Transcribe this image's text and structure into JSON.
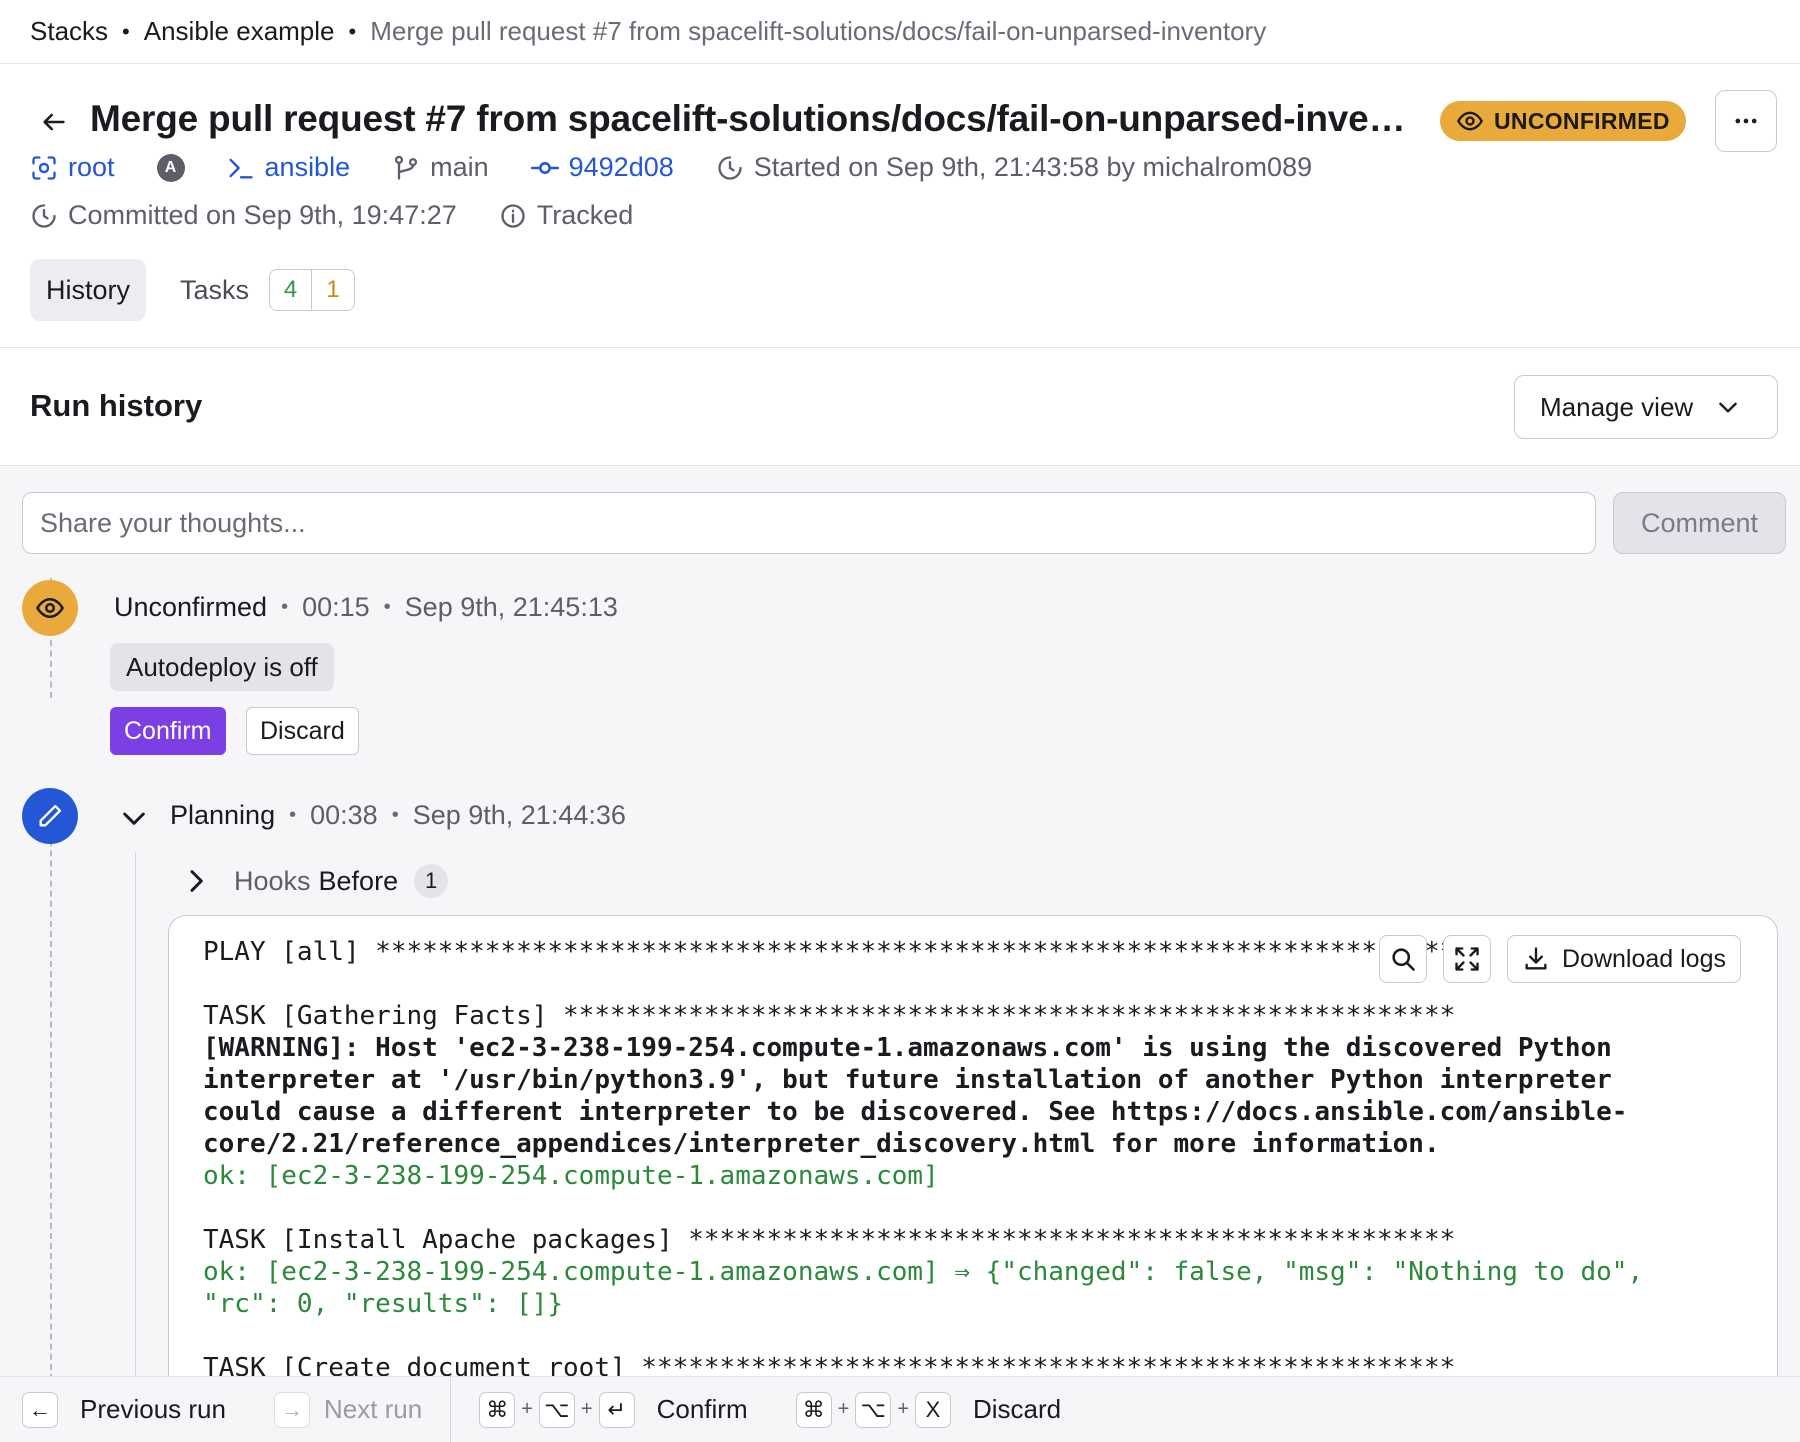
{
  "breadcrumb": {
    "items": [
      "Stacks",
      "Ansible example",
      "Merge pull request #7 from spacelift-solutions/docs/fail-on-unparsed-inventory"
    ],
    "separator": "•"
  },
  "header": {
    "title": "Merge pull request #7 from spacelift-solutions/docs/fail-on-unparsed-inventory",
    "status": "UNCONFIRMED",
    "status_color": "#e9a93b",
    "space": "root",
    "avatar_letter": "A",
    "stack": "ansible",
    "branch": "main",
    "commit": "9492d08",
    "started": "Started on Sep 9th, 21:43:58 by michalrom089",
    "committed": "Committed on Sep 9th, 19:47:27",
    "tracked": "Tracked"
  },
  "tabs": {
    "history": "History",
    "tasks": "Tasks",
    "tasks_ok_count": "4",
    "tasks_warn_count": "1"
  },
  "run_history": {
    "title": "Run history",
    "manage_view": "Manage view"
  },
  "comment": {
    "placeholder": "Share your thoughts...",
    "button": "Comment"
  },
  "timeline": {
    "unconfirmed": {
      "name": "Unconfirmed",
      "duration": "00:15",
      "timestamp": "Sep 9th, 21:45:13",
      "pill": "Autodeploy is off",
      "confirm": "Confirm",
      "discard": "Discard"
    },
    "planning": {
      "name": "Planning",
      "duration": "00:38",
      "timestamp": "Sep 9th, 21:44:36",
      "hooks_prefix": "Hooks",
      "hooks_label": "Before",
      "hooks_count": "1"
    }
  },
  "logs": {
    "download": "Download logs",
    "lines": [
      {
        "text": "PLAY [all] ***********************************************************************",
        "style": "normal"
      },
      {
        "text": "",
        "style": "normal"
      },
      {
        "text": "TASK [Gathering Facts] *********************************************************",
        "style": "normal"
      },
      {
        "text": "[WARNING]: Host 'ec2-3-238-199-254.compute-1.amazonaws.com' is using the discovered Python",
        "style": "bold"
      },
      {
        "text": "interpreter at '/usr/bin/python3.9', but future installation of another Python interpreter",
        "style": "bold"
      },
      {
        "text": "could cause a different interpreter to be discovered. See https://docs.ansible.com/ansible-",
        "style": "bold"
      },
      {
        "text": "core/2.21/reference_appendices/interpreter_discovery.html for more information.",
        "style": "bold"
      },
      {
        "text": "ok: [ec2-3-238-199-254.compute-1.amazonaws.com]",
        "style": "ok"
      },
      {
        "text": "",
        "style": "normal"
      },
      {
        "text": "TASK [Install Apache packages] *************************************************",
        "style": "normal"
      },
      {
        "text": "ok: [ec2-3-238-199-254.compute-1.amazonaws.com] ⇒ {\"changed\": false, \"msg\": \"Nothing to do\",",
        "style": "ok"
      },
      {
        "text": "\"rc\": 0, \"results\": []}",
        "style": "ok"
      },
      {
        "text": "",
        "style": "normal"
      },
      {
        "text": "TASK [Create document root] ****************************************************",
        "style": "normal"
      }
    ]
  },
  "footer": {
    "previous": "Previous run",
    "next": "Next run",
    "confirm": "Confirm",
    "discard": "Discard",
    "key_cmd": "⌘",
    "key_opt": "⌥",
    "key_enter": "↵",
    "key_x": "X",
    "key_plus": "+",
    "key_left": "←",
    "key_right": "→"
  },
  "colors": {
    "accent_purple": "#7b3fe4",
    "link_blue": "#2357d6",
    "log_ok_green": "#2a8a3a"
  }
}
